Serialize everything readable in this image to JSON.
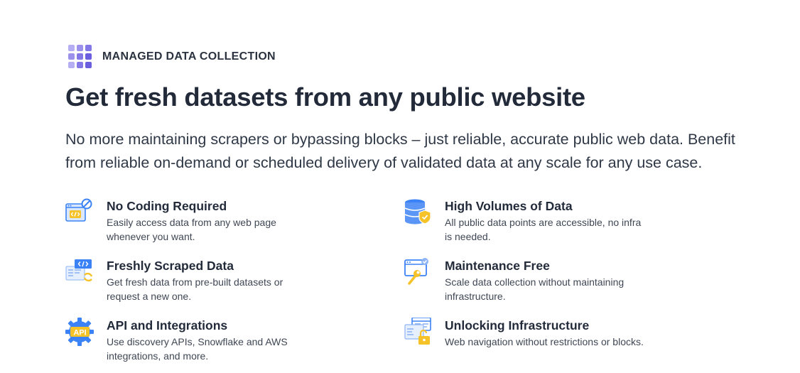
{
  "eyebrow": {
    "label": "MANAGED DATA COLLECTION",
    "icon": "grid-icon",
    "dot_colors": [
      "#b6aef2",
      "#9c92ec",
      "#8378e6",
      "#9c92ec",
      "#8378e6",
      "#6b5fe0",
      "#b6aef2",
      "#8378e6",
      "#6b5fe0"
    ]
  },
  "title": "Get fresh datasets from any public website",
  "description": "No more maintaining scrapers or bypassing blocks – just reliable, accurate public web data. Benefit from reliable on-demand or scheduled delivery of validated data at any scale for any use case.",
  "features": [
    {
      "title": "No Coding Required",
      "description": "Easily access data from any web page whenever you want.",
      "icon": "code-browser-icon"
    },
    {
      "title": "High Volumes of Data",
      "description": "All public data points are accessible, no infra is needed.",
      "icon": "database-shield-icon"
    },
    {
      "title": "Freshly Scraped Data",
      "description": "Get fresh data from pre-built datasets or request a new one.",
      "icon": "refresh-code-icon"
    },
    {
      "title": "Maintenance Free",
      "description": "Scale data collection without maintaining infrastructure.",
      "icon": "wrench-window-icon"
    },
    {
      "title": "API and Integrations",
      "description": "Use discovery APIs, Snowflake and AWS integrations, and more.",
      "icon": "api-gear-icon"
    },
    {
      "title": "Unlocking Infrastructure",
      "description": "Web navigation without restrictions or blocks.",
      "icon": "unlock-window-icon"
    }
  ],
  "colors": {
    "accent_blue": "#3b82f6",
    "accent_yellow": "#f5c228",
    "text_dark": "#232b3a"
  }
}
